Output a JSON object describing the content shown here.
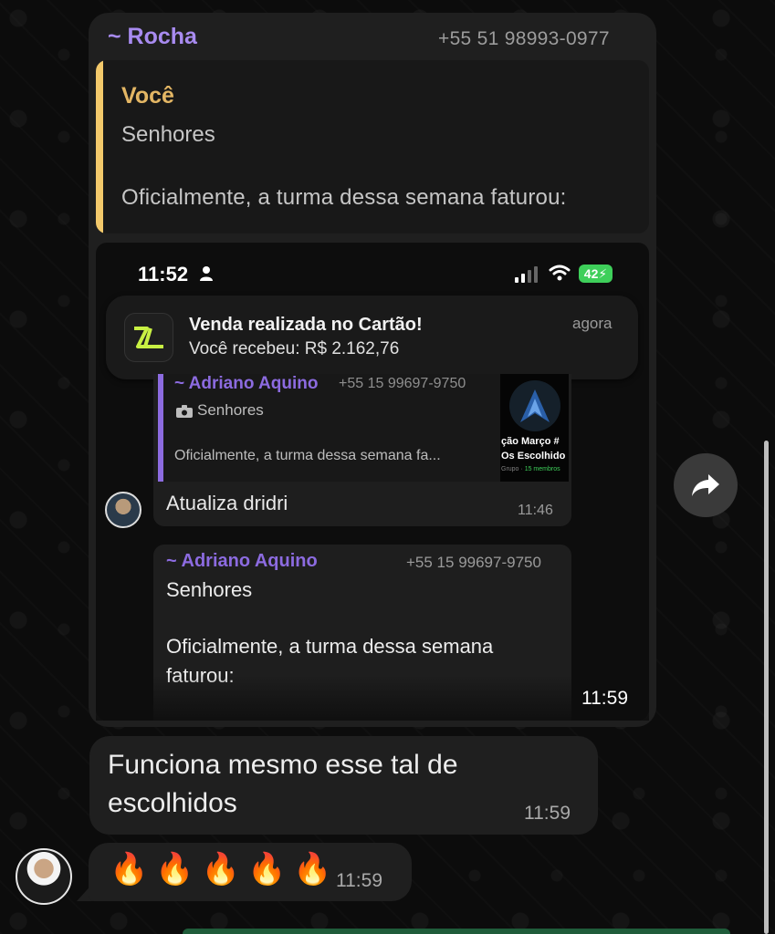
{
  "forwarded_message": {
    "sender_name": "~ Rocha",
    "sender_phone": "+55 51 98993-0977",
    "quote": {
      "author": "Você",
      "line1": "Senhores",
      "line2": "Oficialmente, a turma dessa semana faturou:"
    },
    "time": "11:59"
  },
  "screenshot": {
    "status_time": "11:52",
    "battery": "42",
    "notification": {
      "title": "Venda realizada no Cartão!",
      "body": "Você recebeu: R$ 2.162,76",
      "time": "agora"
    },
    "inner_message1": {
      "quote_name": "~ Adriano Aquino",
      "quote_phone": "+55 15 99697-9750",
      "quote_media_label": "Senhores",
      "quote_text": "Oficialmente, a turma dessa semana fa...",
      "thumb_line1": "ção Março #",
      "thumb_line2": "Os Escolhido",
      "thumb_line3_prefix": "Grupo · ",
      "thumb_line3_members": "15 membros",
      "text": "Atualiza dridri",
      "time": "11:46"
    },
    "inner_message2": {
      "name": "~ Adriano Aquino",
      "phone": "+55 15 99697-9750",
      "line1": "Senhores",
      "line2": "Oficialmente, a turma dessa semana",
      "line3": "faturou:"
    }
  },
  "message2": {
    "line1": "Funciona mesmo esse tal de",
    "line2": "escolhidos",
    "time": "11:59"
  },
  "message3": {
    "text": "🔥🔥🔥🔥🔥",
    "time": "11:59"
  },
  "colors": {
    "sender_purple": "#a88bf0",
    "quote_yellow": "#f3c96b",
    "bubble_bg": "#1f1f1f"
  }
}
